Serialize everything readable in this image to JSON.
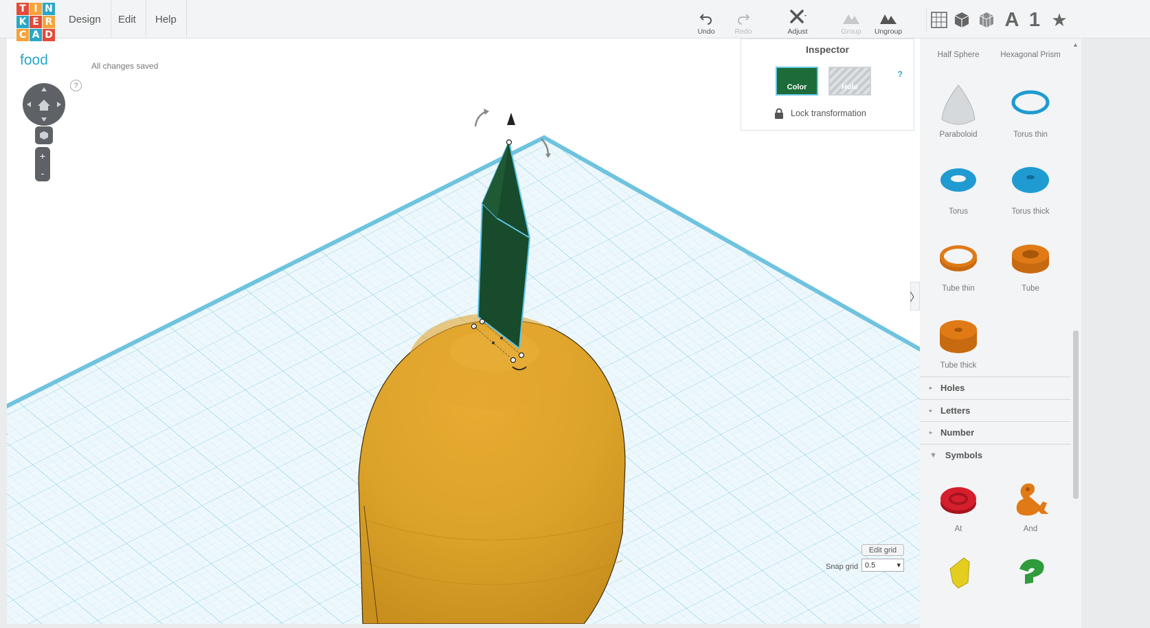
{
  "logo": {
    "letters": [
      "T",
      "I",
      "N",
      "K",
      "E",
      "R",
      "C",
      "A",
      "D"
    ],
    "colors": [
      "#e24b39",
      "#f6a33a",
      "#2aa7c6",
      "#2aa7c6",
      "#e24b39",
      "#f6a33a",
      "#f6a33a",
      "#2aa7c6",
      "#e24b39"
    ]
  },
  "menu": {
    "design": "Design",
    "edit": "Edit",
    "help": "Help"
  },
  "toolbar": {
    "undo": "Undo",
    "redo": "Redo",
    "adjust": "Adjust",
    "group": "Group",
    "ungroup": "Ungroup",
    "letter_view": "A",
    "number_view": "1",
    "star_view": "★"
  },
  "design": {
    "title": "food",
    "save_status": "All changes saved"
  },
  "nav": {
    "help": "?",
    "zoom_in": "+",
    "zoom_out": "-"
  },
  "inspector": {
    "title": "Inspector",
    "help": "?",
    "color_label": "Color",
    "hole_label": "Hole",
    "lock_label": "Lock transformation",
    "selected_color": "#1d6b38"
  },
  "grid": {
    "edit_grid": "Edit grid",
    "snap_label": "Snap grid",
    "snap_value": "0.5",
    "snap_arrow": "▾"
  },
  "collapse": "〉",
  "shapes": [
    {
      "label": "Half Sphere",
      "icon": "half-sphere-icon",
      "color": "#c9187d"
    },
    {
      "label": "Hexagonal Prism",
      "icon": "hexagonal-prism-icon",
      "color": "#8b5a2b"
    },
    {
      "label": "Paraboloid",
      "icon": "paraboloid-icon",
      "color": "#cfd2d5"
    },
    {
      "label": "Torus thin",
      "icon": "torus-thin-icon",
      "color": "#1f9bd1"
    },
    {
      "label": "Torus",
      "icon": "torus-icon",
      "color": "#1f9bd1"
    },
    {
      "label": "Torus thick",
      "icon": "torus-thick-icon",
      "color": "#1f9bd1"
    },
    {
      "label": "Tube thin",
      "icon": "tube-thin-icon",
      "color": "#e07a16"
    },
    {
      "label": "Tube",
      "icon": "tube-icon",
      "color": "#e07a16"
    },
    {
      "label": "Tube thick",
      "icon": "tube-thick-icon",
      "color": "#e07a16"
    }
  ],
  "categories": [
    {
      "label": "Holes",
      "expanded": false
    },
    {
      "label": "Letters",
      "expanded": false
    },
    {
      "label": "Number",
      "expanded": false
    },
    {
      "label": "Symbols",
      "expanded": true
    }
  ],
  "symbols": [
    {
      "label": "At",
      "icon": "at-symbol-icon",
      "color": "#d61f2c"
    },
    {
      "label": "And",
      "icon": "ampersand-icon",
      "color": "#e07a16"
    }
  ],
  "scroll": {
    "up": "▲"
  }
}
